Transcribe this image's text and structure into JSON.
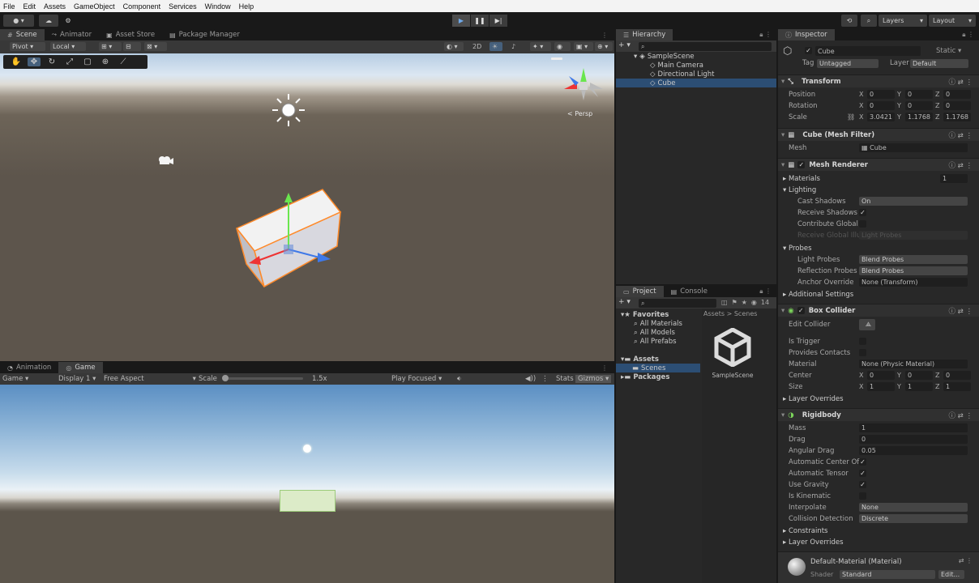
{
  "menu": [
    "File",
    "Edit",
    "Assets",
    "GameObject",
    "Component",
    "Services",
    "Window",
    "Help"
  ],
  "toolbar": {
    "layers": "Layers",
    "layout": "Layout"
  },
  "scene_tabs": [
    {
      "label": "Scene",
      "icon": "grid-icon"
    },
    {
      "label": "Animator",
      "icon": "animator-icon"
    },
    {
      "label": "Asset Store",
      "icon": "store-icon"
    },
    {
      "label": "Package Manager",
      "icon": "package-icon"
    }
  ],
  "scene_tools": {
    "pivot": "Pivot",
    "local": "Local"
  },
  "scene_view": {
    "persp": "< Persp"
  },
  "hierarchy": {
    "tab": "Hierarchy",
    "items": [
      "SampleScene",
      "Main Camera",
      "Directional Light",
      "Cube"
    ],
    "selected": "Cube"
  },
  "project": {
    "tabs": [
      "Project",
      "Console"
    ],
    "favorites_label": "Favorites",
    "favorites": [
      "All Materials",
      "All Models",
      "All Prefabs"
    ],
    "assets_label": "Assets",
    "assets_children": [
      "Scenes"
    ],
    "packages_label": "Packages",
    "breadcrumb": [
      "Assets",
      "Scenes"
    ],
    "asset_name": "SampleScene",
    "count": "14"
  },
  "game_tabs": [
    "Animation",
    "Game"
  ],
  "game_bar": {
    "mode": "Game",
    "display": "Display 1",
    "aspect": "Free Aspect",
    "scale_label": "Scale",
    "scale_value": "1.5x",
    "play_focused": "Play Focused",
    "stats": "Stats",
    "gizmos": "Gizmos"
  },
  "inspector": {
    "tab": "Inspector",
    "object_name": "Cube",
    "static_label": "Static",
    "tag_label": "Tag",
    "tag_value": "Untagged",
    "layer_label": "Layer",
    "layer_value": "Default",
    "transform": {
      "title": "Transform",
      "position_label": "Position",
      "position": {
        "x": "0",
        "y": "0",
        "z": "0"
      },
      "rotation_label": "Rotation",
      "rotation": {
        "x": "0",
        "y": "0",
        "z": "0"
      },
      "scale_label": "Scale",
      "scale": {
        "x": "3.0421",
        "y": "1.1768",
        "z": "1.1768"
      }
    },
    "mesh_filter": {
      "title": "Cube (Mesh Filter)",
      "mesh_label": "Mesh",
      "mesh_value": "Cube"
    },
    "mesh_renderer": {
      "title": "Mesh Renderer",
      "materials_label": "Materials",
      "materials_count": "1",
      "lighting_label": "Lighting",
      "cast_shadows_label": "Cast Shadows",
      "cast_shadows_value": "On",
      "receive_shadows_label": "Receive Shadows",
      "contribute_gi_label": "Contribute Global",
      "receive_gi_label": "Receive Global Illumination",
      "receive_gi_value": "Light Probes",
      "probes_label": "Probes",
      "light_probes_label": "Light Probes",
      "light_probes_value": "Blend Probes",
      "reflection_probes_label": "Reflection Probes",
      "reflection_probes_value": "Blend Probes",
      "anchor_override_label": "Anchor Override",
      "anchor_override_value": "None (Transform)",
      "additional_settings": "Additional Settings"
    },
    "box_collider": {
      "title": "Box Collider",
      "edit_collider_label": "Edit Collider",
      "is_trigger_label": "Is Trigger",
      "provides_contacts_label": "Provides Contacts",
      "material_label": "Material",
      "material_value": "None (Physic Material)",
      "center_label": "Center",
      "center": {
        "x": "0",
        "y": "0",
        "z": "0"
      },
      "size_label": "Size",
      "size": {
        "x": "1",
        "y": "1",
        "z": "1"
      },
      "layer_overrides": "Layer Overrides"
    },
    "rigidbody": {
      "title": "Rigidbody",
      "mass_label": "Mass",
      "mass": "1",
      "drag_label": "Drag",
      "drag": "0",
      "angular_drag_label": "Angular Drag",
      "angular_drag": "0.05",
      "auto_center_label": "Automatic Center Of",
      "auto_tensor_label": "Automatic Tensor",
      "use_gravity_label": "Use Gravity",
      "is_kinematic_label": "Is Kinematic",
      "interpolate_label": "Interpolate",
      "interpolate_value": "None",
      "collision_label": "Collision Detection",
      "collision_value": "Discrete",
      "constraints_label": "Constraints",
      "layer_overrides": "Layer Overrides"
    },
    "material": {
      "title": "Default-Material (Material)",
      "shader_label": "Shader",
      "shader_value": "Standard",
      "edit_label": "Edit..."
    }
  }
}
